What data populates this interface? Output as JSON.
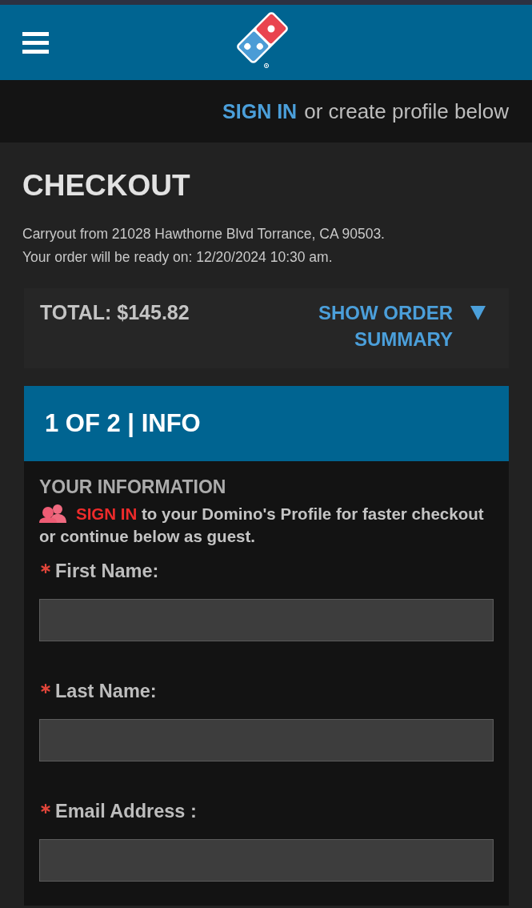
{
  "sign_in_bar": {
    "link": "SIGN IN",
    "text": "or create profile below"
  },
  "checkout": {
    "title": "CHECKOUT",
    "details": [
      "Carryout from 21028 Hawthorne Blvd Torrance, CA 90503.",
      "Your order will be ready on: 12/20/2024 10:30 am."
    ]
  },
  "order_total": {
    "total": "TOTAL: $145.82",
    "toggle": "SHOW ORDER SUMMARY",
    "expanded": false
  },
  "step": {
    "title": "1 OF 2 | INFO",
    "heading": "YOUR INFORMATION",
    "sign_in": {
      "link": "SIGN IN",
      "text": "to your Domino's Profile for faster checkout or continue below as guest."
    },
    "fields": [
      {
        "label": "First Name:",
        "required": true
      },
      {
        "label": "Last Name:",
        "required": true
      },
      {
        "label": "Email Address :",
        "required": true
      }
    ]
  }
}
